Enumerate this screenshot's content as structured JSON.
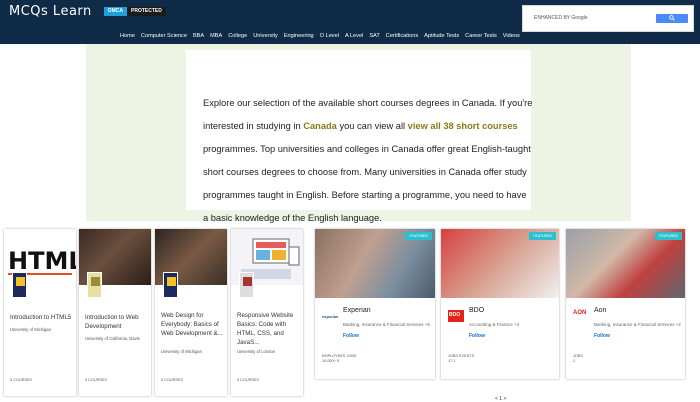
{
  "header": {
    "logo": "MCQs Learn",
    "dmca_left": "DMCA",
    "dmca_right": "PROTECTED",
    "search_placeholder": "ENHANCED BY Google"
  },
  "nav": [
    "Home",
    "Computer Science",
    "BBA",
    "MBA",
    "College",
    "University",
    "Engineering",
    "O Level",
    "A Level",
    "SAT",
    "Certifications",
    "Aptitude Tests",
    "Career Tests",
    "Videos"
  ],
  "intro": {
    "p1": "Explore our selection of the available short courses degrees in Canada. If you're interested in studying in ",
    "link1": "Canada",
    "p2": " you can view all ",
    "link2": "view all 38 short courses",
    "p3": " programmes. Top universities and colleges in Canada offer great English-taught short courses degrees to choose from. Many universities in Canada offer study programmes taught in English. Before starting a programme, you need to have a basic knowledge of the English language."
  },
  "courses": [
    {
      "title": "Introduction to HTML5",
      "uni": "University of Michigan",
      "foot": "5 COURSES"
    },
    {
      "title": "Introduction to Web Development",
      "uni": "University of California, Davis",
      "foot": "5 COURSES"
    },
    {
      "title": "Web Design for Everybody: Basics of Web Development &...",
      "uni": "University of Michigan",
      "foot": "5 COURSES"
    },
    {
      "title": "Responsive Website Basics: Code with HTML, CSS, and JavaS...",
      "uni": "University of London",
      "foot": "5 COURSES"
    }
  ],
  "employers": [
    {
      "tag": "FEATURED",
      "logo": "experian",
      "name": "Experian",
      "industry": "Banking, Insurance & Financial Services +5",
      "follow": "Follow",
      "stats1": "EMPLOYEES  JOBS",
      "stats2": "10,000+  5"
    },
    {
      "tag": "FEATURED",
      "logo": "BDO",
      "name": "BDO",
      "industry": "Accounting & Finance +3",
      "follow": "Follow",
      "stats1": "JOBS  EVENTS",
      "stats2": "17  1"
    },
    {
      "tag": "FEATURED",
      "logo": "AON",
      "name": "Aon",
      "industry": "Banking, Insurance & Financial Services +2",
      "follow": "Follow",
      "stats1": "JOBS",
      "stats2": "2"
    }
  ],
  "pager": "< 1 >"
}
